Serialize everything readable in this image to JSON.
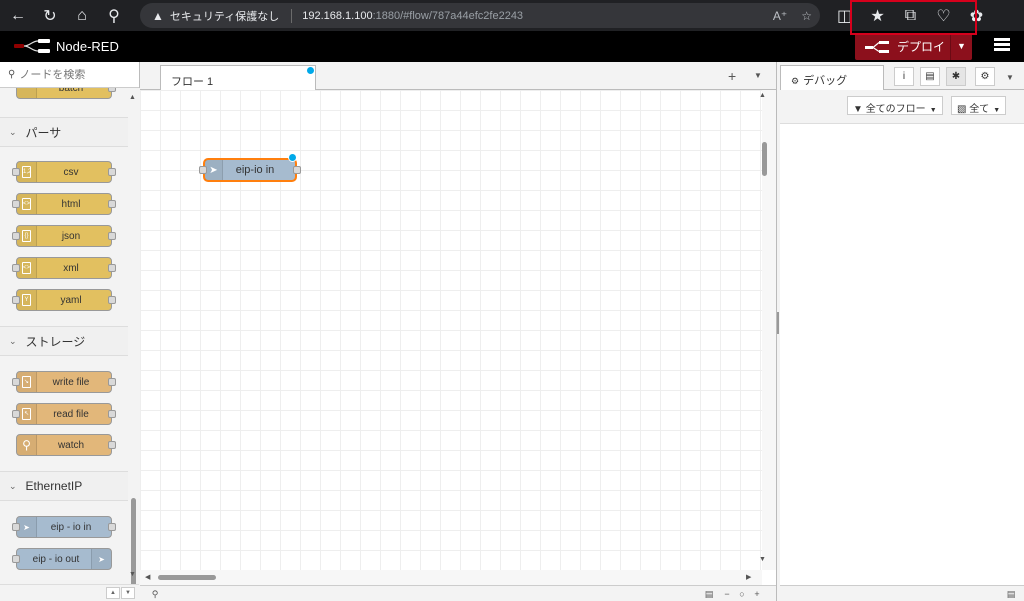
{
  "browser": {
    "security_label": "セキュリティ保護なし",
    "url_host": "192.168.1.100",
    "url_rest": ":1880/#flow/787a44efc2fe2243",
    "icons": [
      "back-arrow-icon",
      "reload-icon",
      "home-icon",
      "search-icon",
      "read-aloud-icon",
      "favorite-star-icon",
      "split-screen-icon",
      "favorites-icon",
      "collections-icon",
      "browser-essentials-icon",
      "extensions-icon"
    ]
  },
  "header": {
    "title": "Node-RED",
    "deploy_label": "デプロイ",
    "deploy_color": "#8c101c"
  },
  "palette": {
    "search_placeholder": "ノードを検索",
    "partial_node": "batch",
    "categories": [
      {
        "label": "パーサ",
        "nodes": [
          "csv",
          "html",
          "json",
          "xml",
          "yaml"
        ]
      },
      {
        "label": "ストレージ",
        "nodes": [
          "write file",
          "read file",
          "watch"
        ]
      },
      {
        "label": "EthernetIP",
        "nodes": [
          "eip - io in",
          "eip - io out"
        ]
      }
    ],
    "colors": {
      "parser": "#e2c060",
      "storage": "#e2b77a",
      "ethernetip": "#a6bbcf"
    }
  },
  "workspace": {
    "tab_label": "フロー 1",
    "node_label": "eip-io in"
  },
  "sidebar": {
    "debug_tab": "デバッグ",
    "filter_label": "全てのフロー",
    "clear_label": "全て"
  }
}
